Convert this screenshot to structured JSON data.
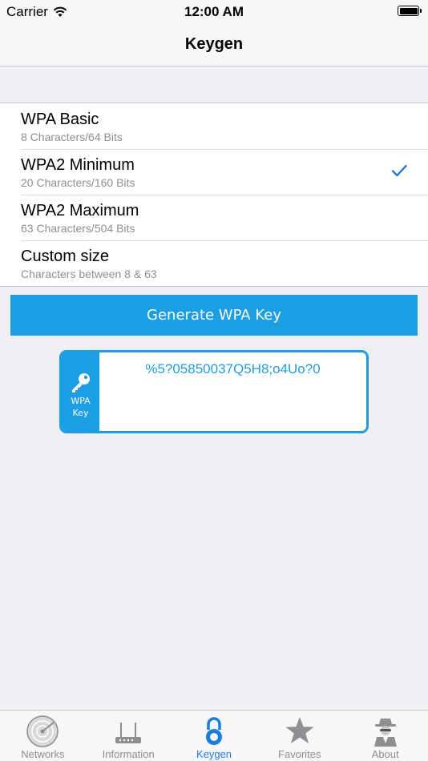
{
  "status_bar": {
    "carrier": "Carrier",
    "time": "12:00 AM"
  },
  "nav": {
    "title": "Keygen"
  },
  "options": [
    {
      "title": "WPA Basic",
      "subtitle": "8 Characters/64 Bits",
      "selected": false
    },
    {
      "title": "WPA2 Minimum",
      "subtitle": "20 Characters/160 Bits",
      "selected": true
    },
    {
      "title": "WPA2 Maximum",
      "subtitle": "63 Characters/504 Bits",
      "selected": false
    },
    {
      "title": "Custom size",
      "subtitle": "Characters between 8 & 63",
      "selected": false
    }
  ],
  "generate_button": {
    "label": "Generate WPA Key"
  },
  "key_card": {
    "label_line1": "WPA",
    "label_line2": "Key",
    "value": "%5?05850037Q5H8;o4Uo?0",
    "icon": "key-icon"
  },
  "tabs": [
    {
      "label": "Networks",
      "icon": "radar-icon",
      "active": false
    },
    {
      "label": "Information",
      "icon": "router-icon",
      "active": false
    },
    {
      "label": "Keygen",
      "icon": "padlock-icon",
      "active": true
    },
    {
      "label": "Favorites",
      "icon": "star-icon",
      "active": false
    },
    {
      "label": "About",
      "icon": "spy-icon",
      "active": false
    }
  ],
  "colors": {
    "accent": "#1a9ee4",
    "tab_active": "#1a7de0",
    "background": "#efeff4"
  }
}
